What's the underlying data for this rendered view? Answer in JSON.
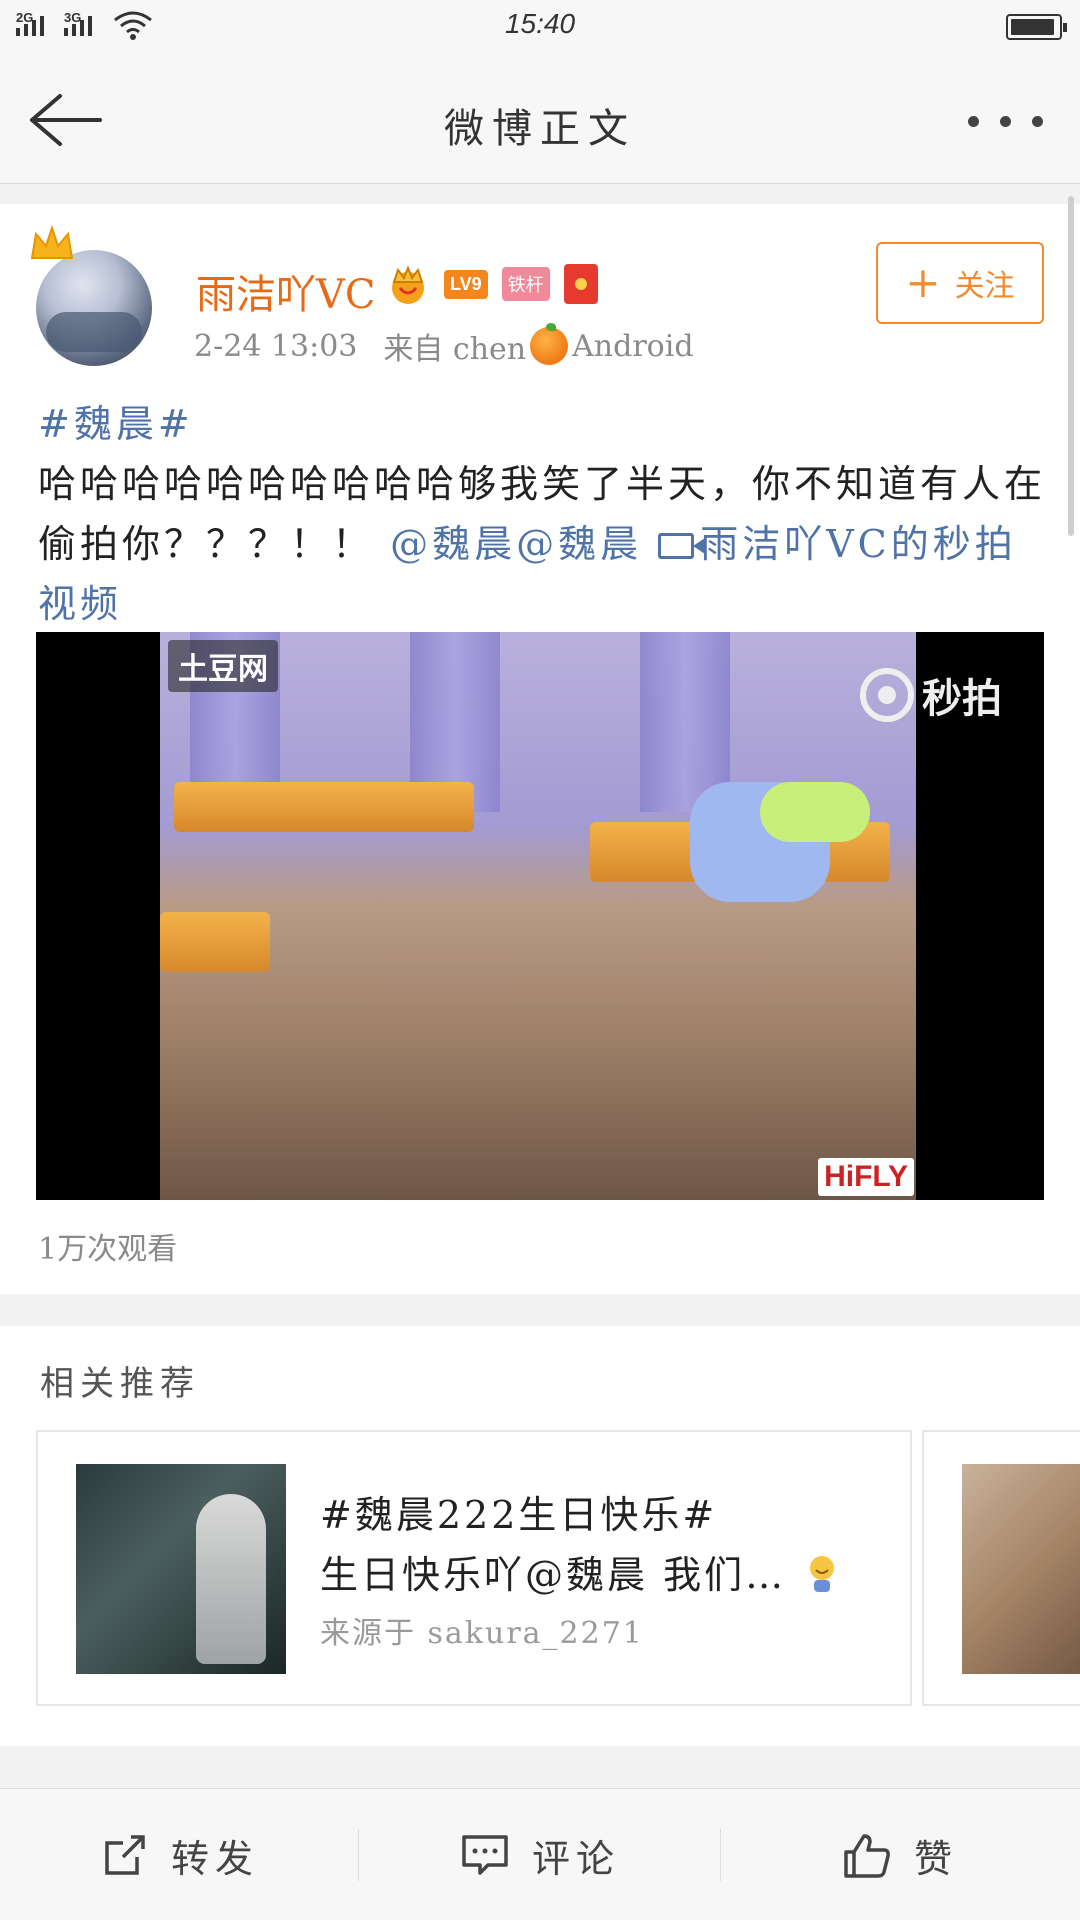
{
  "status_bar": {
    "signal_1": "2G",
    "signal_2": "3G",
    "time": "15:40"
  },
  "nav": {
    "title": "微博正文"
  },
  "post": {
    "username": "雨洁吖VC",
    "badges": {
      "level": "LV9",
      "tie": "铁杆"
    },
    "time": "2-24 13:03",
    "source_prefix": "来自 chen",
    "source_suffix": " Android",
    "follow_label": "关注",
    "hashtag": "#魏晨#",
    "body_text": "哈哈哈哈哈哈哈哈哈哈够我笑了半天，你不知道有人在偷拍你？？？！！",
    "mention": "@魏晨@魏晨",
    "video_link": "雨洁吖VC的秒拍视频",
    "video": {
      "watermark_left": "土豆网",
      "watermark_right": "秒拍",
      "watermark_corner": "HiFLY"
    },
    "views": "1万次观看"
  },
  "related": {
    "title": "相关推荐",
    "items": [
      {
        "line1": "#魏晨222生日快乐#",
        "line2": "生日快乐吖@魏晨 我们…",
        "source": "来源于 sakura_2271"
      }
    ]
  },
  "bottom_bar": {
    "repost": "转发",
    "comment": "评论",
    "like": "赞"
  },
  "colors": {
    "accent_orange": "#e86a15",
    "link_blue": "#4f73a8"
  }
}
